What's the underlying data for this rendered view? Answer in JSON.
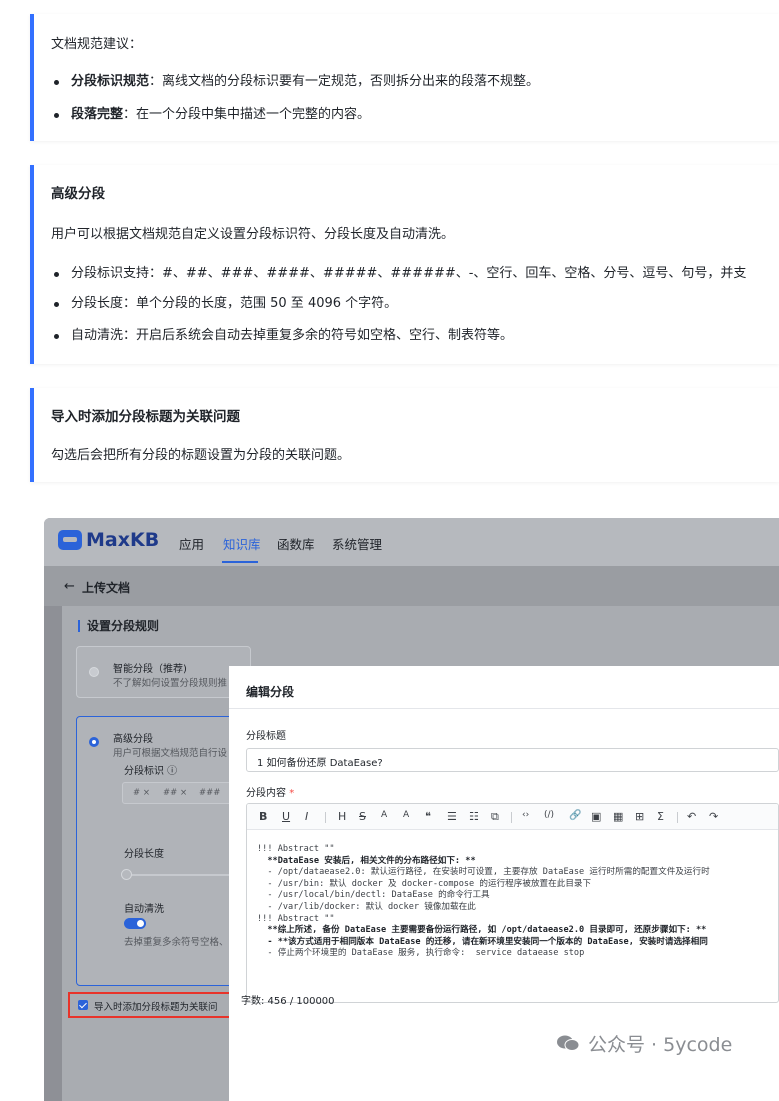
{
  "tip1": {
    "intro": "文档规范建议：",
    "items": [
      {
        "bold": "分段标识规范",
        "text": "：离线文档的分段标识要有一定规范，否则拆分出来的段落不规整。"
      },
      {
        "bold": "段落完整",
        "text": "：在一个分段中集中描述一个完整的内容。"
      }
    ]
  },
  "tip2": {
    "heading": "高级分段",
    "desc": "用户可以根据文档规范自定义设置分段标识符、分段长度及自动清洗。",
    "items": [
      "分段标识支持：#、##、###、####、#####、######、-、空行、回车、空格、分号、逗号、句号，并支",
      "分段长度：单个分段的长度，范围 50 至 4096 个字符。",
      "自动清洗：开启后系统会自动去掉重复多余的符号如空格、空行、制表符等。"
    ]
  },
  "tip3": {
    "heading": "导入时添加分段标题为关联问题",
    "desc": "勾选后会把所有分段的标题设置为分段的关联问题。"
  },
  "app": {
    "brand": "MaxKB",
    "nav": [
      "应用",
      "知识库",
      "函数库",
      "系统管理"
    ],
    "back_label": "上传文档",
    "section_title": "设置分段规则",
    "smart": {
      "title": "智能分段（推荐)",
      "sub": "不了解如何设置分段规则推"
    },
    "advanced": {
      "title": "高级分段",
      "sub": "用户可根据文档规范自行设"
    },
    "seg_id_label": "分段标识 ⓘ",
    "tags": [
      "# ×",
      "## ×",
      "###"
    ],
    "seg_len_label": "分段长度",
    "auto_clean_label": "自动清洗",
    "auto_clean_desc": "去掉重复多余符号空格、",
    "import_check_label": "导入时添加分段标题为关联问"
  },
  "dialog": {
    "title": "编辑分段",
    "title_label": "分段标题",
    "title_value": "1 如何备份还原 DataEase?",
    "content_label": "分段内容",
    "required_mark": "*",
    "toolbar": [
      "B",
      "U",
      "I",
      "H",
      "S",
      "A",
      "A",
      "❝",
      "☰",
      "☷",
      "⧉",
      "‹›",
      "(/)",
      "🔗",
      "▣",
      "▦",
      "⊞",
      "Σ",
      "↶",
      "↷"
    ],
    "content_lines": [
      "!!! Abstract \"\"",
      "  **DataEase 安装后, 相关文件的分布路径如下: **",
      "  - /opt/dataease2.0: 默认运行路径, 在安装时可设置, 主要存放 DataEase 运行时所需的配置文件及运行时",
      "  - /usr/bin: 默认 docker 及 docker-compose 的运行程序被放置在此目录下",
      "  - /usr/local/bin/dectl: DataEase 的命令行工具",
      "  - /var/lib/docker: 默认 docker 镜像加载在此",
      "!!! Abstract \"\"",
      "  **综上所述, 备份 DataEase 主要需要备份运行路径, 如 /opt/dataease2.0 目录即可, 还原步骤如下: **",
      "  - **该方式适用于相同版本 DataEase 的迁移, 请在新环境里安装同一个版本的 DataEase, 安装时请选择相同",
      "  - 停止两个环境里的 DataEase 服务, 执行命令:  service dataease stop"
    ],
    "word_count": "字数: 456 / 100000"
  },
  "watermark": "公众号 · 5ycode",
  "colors": {
    "accent": "#3370ff",
    "brand": "#2b63d9",
    "highlight_border": "#e8332a"
  }
}
